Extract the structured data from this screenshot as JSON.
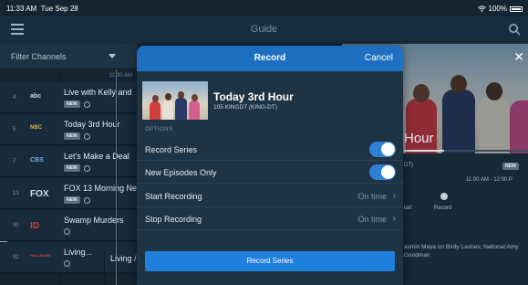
{
  "status_bar": {
    "time": "11:33 AM",
    "date": "Tue Sep 28",
    "battery": "100%"
  },
  "header": {
    "title": "Guide",
    "menu_icon": "hamburger-icon",
    "search_icon": "search-icon"
  },
  "guide": {
    "filter_label": "Filter Channels",
    "time_label": "11:30 AM",
    "rows": [
      {
        "number": "4",
        "logo": "abc",
        "program": "Live with Kelly and",
        "new": "NEW"
      },
      {
        "number": "5",
        "logo": "NBC",
        "program": "Today 3rd Hour",
        "new": "NEW"
      },
      {
        "number": "7",
        "logo": "CBS",
        "program": "Let's Make a Deal",
        "new": "NEW"
      },
      {
        "number": "13",
        "logo": "FOX",
        "program": "FOX 13 Morning Ne",
        "new": "NEW"
      },
      {
        "number": "90",
        "logo": "ID",
        "program": "Swamp Murders",
        "new": ""
      },
      {
        "number": "92",
        "logo": "HALLMARK",
        "program": "Living...",
        "new": ""
      }
    ],
    "row6_second_program": "Living /"
  },
  "details_panel": {
    "title_partial": "Hour",
    "channel_partial": "DT)",
    "new_badge": "NEW",
    "time_range": "11:00 AM - 12:00 P",
    "start_label": "tart",
    "record_label": "Record",
    "description": "asmin Maya on Birdy Lashes; National Amy Goodman.",
    "close_icon": "close-icon"
  },
  "modal": {
    "title": "Record",
    "cancel_label": "Cancel",
    "show_title": "Today 3rd Hour",
    "channel": "105 KINGDT (KING-DT)",
    "options_header": "OPTIONS",
    "options": {
      "record_series": {
        "label": "Record Series",
        "enabled": true
      },
      "new_episodes_only": {
        "label": "New Episodes Only",
        "enabled": true
      },
      "start_recording": {
        "label": "Start Recording",
        "value": "On time"
      },
      "stop_recording": {
        "label": "Stop Recording",
        "value": "On time"
      }
    },
    "submit_label": "Record Series"
  },
  "colors": {
    "accent": "#1f7fdd",
    "modal_header": "#1f6fc0",
    "background": "#142431",
    "toggle_on": "#2e7fd6"
  }
}
